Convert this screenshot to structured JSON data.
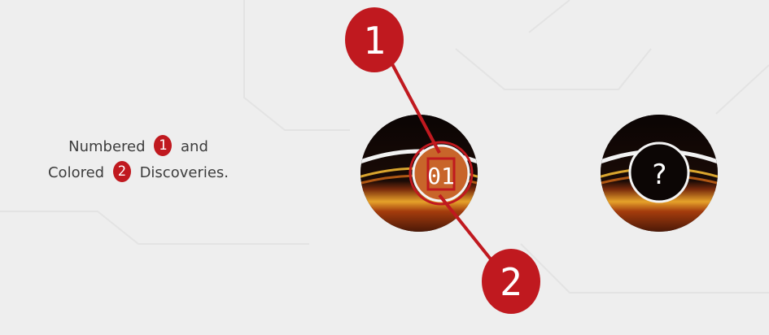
{
  "caption": {
    "line1_before": "Numbered",
    "line1_badge": "1",
    "line1_after": "and",
    "line2_before": "Colored",
    "line2_badge": "2",
    "line2_after": "Discoveries."
  },
  "token_numbered": {
    "number": "01",
    "accent_color": "#c0191f",
    "fill_color": "#c8652a"
  },
  "token_unknown": {
    "symbol": "?"
  },
  "callouts": [
    {
      "label": "1"
    },
    {
      "label": "2"
    }
  ],
  "colors": {
    "background": "#eeeeee",
    "badge_red": "#c0191f",
    "token_dark": "#120805"
  }
}
